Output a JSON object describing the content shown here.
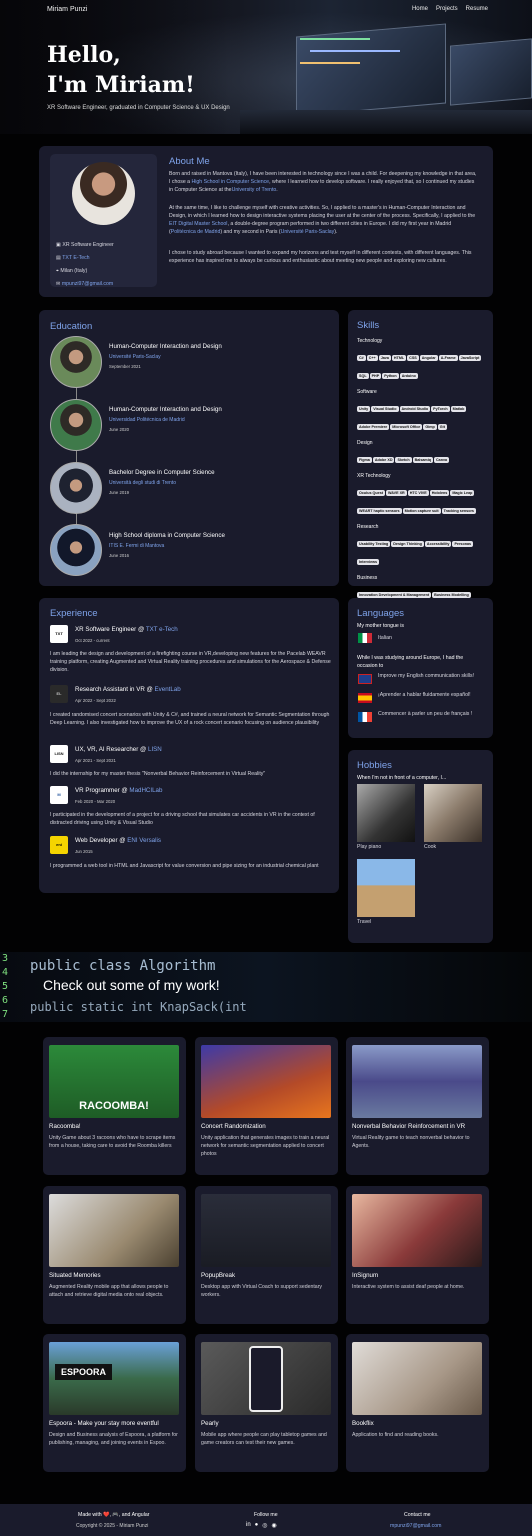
{
  "nav": {
    "brand": "Miriam Punzi",
    "links": [
      "Home",
      "Projects",
      "Resume"
    ]
  },
  "hero": {
    "line1": "Hello,",
    "line2": "I'm Miriam!",
    "subtitle": "XR Software Engineer, graduated in Computer Science & UX Design"
  },
  "profile": {
    "role": "XR Software Engineer",
    "company": "TXT E-Tech",
    "location": "Milan (Italy)",
    "email": "mpunzi97@gmail.com"
  },
  "about": {
    "title": "About Me",
    "p1a": "Born and raised in Mantova (Italy), I have been interested in technology since I was a child. For deepening my knowledge in that area, I chose a ",
    "p1l1": "High School in Computer Science",
    "p1b": ", where I learned how to develop software. I really enjoyed that, so I continued my studies in Computer Science at the",
    "p1l2": "University of Trento",
    "p1c": ".",
    "p2a": "At the same time, I like to challenge myself with creative activities. So, I applied to a master's in Human-Computer Interaction and Design, in which I learned how to design interactive systems placing the user at the center of the process. Specifically, I applied to the ",
    "p2l1": "EIT Digital Master School",
    "p2b": ", a double-degree program performed in two different cities in Europe. I did my first year in Madrid (",
    "p2l2": "Politécnica de Madrid",
    "p2c": ") and my second in Paris (",
    "p2l3": "Université Paris-Saclay",
    "p2d": ").",
    "p3": "I chose to study abroad because I wanted to expand my horizons and test myself in different contexts, with different languages. This experience has inspired me to always be curious and enthusiastic about meeting new people and exploring new cultures."
  },
  "education": {
    "title": "Education",
    "items": [
      {
        "title": "Human-Computer Interaction and Design",
        "school": "Université Paris-Saclay",
        "date": "September 2021"
      },
      {
        "title": "Human-Computer Interaction and Design",
        "school": "Universidad Politécnica de Madrid",
        "date": "June 2020"
      },
      {
        "title": "Bachelor Degree in Computer Science",
        "school": "Università degli studi di Trento",
        "date": "June 2019"
      },
      {
        "title": "High School diploma in Computer Science",
        "school": "ITIS E. Fermi di Mantova",
        "date": "June 2016"
      }
    ]
  },
  "skills": {
    "title": "Skills",
    "groups": [
      {
        "name": "Technology",
        "tags": [
          "C#",
          "C++",
          "Java",
          "HTML",
          "CSS",
          "Angular",
          "A-Frame",
          "JavaScript",
          "SQL",
          "PHP",
          "Python",
          "Arduino"
        ]
      },
      {
        "name": "Software",
        "tags": [
          "Unity",
          "Visual Studio",
          "Android Studio",
          "PyTorch",
          "Matlab",
          "Adobe Premiere",
          "Microsoft Office",
          "Gimp",
          "Git"
        ]
      },
      {
        "name": "Design",
        "tags": [
          "Figma",
          "Adobe XD",
          "Sketch",
          "Balsamiq",
          "Canva"
        ]
      },
      {
        "name": "XR Technology",
        "tags": [
          "Oculus Quest",
          "WAVE XR",
          "HTC VIVE",
          "Hololens",
          "Magic Leap",
          "WEART haptic sensors",
          "Motion capture suit",
          "Tracking sensors"
        ]
      },
      {
        "name": "Research",
        "tags": [
          "Usability Testing",
          "Design Thinking",
          "Accessibility",
          "Personas",
          "Interviews"
        ]
      },
      {
        "name": "Business",
        "tags": [
          "Innovation Development & Management",
          "Business Modelling",
          "Pitching"
        ]
      }
    ]
  },
  "experience": {
    "title": "Experience",
    "items": [
      {
        "role": "XR Software Engineer @ ",
        "org": "TXT e-Tech",
        "logo": "TXT",
        "date": "Oct 2022 - current",
        "desc": "I am leading the design and development of a firefighting course in VR,developing new features for the Pacelab WEAVR training platform, creating Augmented and Virtual Reality training procedures and simulations for the Aerospace & Defense division."
      },
      {
        "role": "Research Assistant in VR @ ",
        "org": "EventLab",
        "logo": "EL",
        "date": "Apr 2022 - Sept 2022",
        "desc": "I created randomised concert scenarios with Unity & C#, and trained a neural network for Semantic Segmentation through Deep Learning. I also investigated how to improve the UX of a rock concert scenario focusing on audience plausibility"
      },
      {
        "role": "UX, VR, AI Researcher @ ",
        "org": "LISN",
        "logo": "LISN",
        "date": "Apr 2021 - Sept 2021",
        "desc": "I did the internship for my master thesis \"Nonverbal Behavior Reinforcement in Virtual Reality\""
      },
      {
        "role": "VR Programmer @ ",
        "org": "MadHCILab",
        "logo": "M",
        "date": "Feb 2020 - Mar 2020",
        "desc": "I participated in the development of a project for a driving school that simulates car accidents in VR in the context of distracted driving using Unity & Visual Studio"
      },
      {
        "role": "Web Developer @ ",
        "org": "ENI Versalis",
        "logo": "eni",
        "date": "Jun 2015",
        "desc": "I programmed a web tool in HTML and Javascript for value conversion and pipe sizing for an industrial chemical plant"
      }
    ]
  },
  "languages": {
    "title": "Languages",
    "mother_label": "My mother tongue is",
    "mother": "Italian",
    "abroad_label": "While I was studying around Europe, I had the occasion to",
    "items": [
      "Improve my English communication skills!",
      "¡Aprender a hablar fluidamente español!",
      "Commencer à parler un peu de français !"
    ]
  },
  "hobbies": {
    "title": "Hobbies",
    "intro": "When I'm not in front of a computer, I...",
    "items": [
      "Play piano",
      "Cook",
      "Travel"
    ]
  },
  "banner": {
    "title": "Check out some of my work!",
    "code1": "public class Algorithm",
    "code2": "public static int KnapSack(int"
  },
  "projects": [
    {
      "title": "Racoomba!",
      "desc": "Unity Game about 3 racoons who have to scrape items from a house, taking care to avoid the Roomba killers",
      "img_text": "RACOOMBA!"
    },
    {
      "title": "Concert Randomization",
      "desc": "Unity application that generates images to train a neural network for semantic segmentation applied to concert photos",
      "img_text": ""
    },
    {
      "title": "Nonverbal Behavior Reinforcement in VR",
      "desc": "Virtual Reality game to teach nonverbal behavior to Agents.",
      "img_text": ""
    },
    {
      "title": "Situated Memories",
      "desc": "Augmented Reality mobile app that allows people to attach and retrieve digital media onto real objects.",
      "img_text": ""
    },
    {
      "title": "PopupBreak",
      "desc": "Desktop app with Virtual Coach to support sedentary workers.",
      "img_text": ""
    },
    {
      "title": "InSignum",
      "desc": "Interactive system to assist deaf people at home.",
      "img_text": ""
    },
    {
      "title": "Espoora - Make your stay more eventful",
      "desc": "Design and Business analysis of Espoora, a platform for publishing, managing, and joining events in Espoo.",
      "img_text": "ESPOORA"
    },
    {
      "title": "Pearly",
      "desc": "Mobile app where people can play tabletop games and game creators can test their new games.",
      "img_text": ""
    },
    {
      "title": "Bookflix",
      "desc": "Application to find and reading books.",
      "img_text": ""
    }
  ],
  "footer": {
    "made_with": "Made with ❤️, 🎮, and Angular",
    "copyright": "Copyright © 2025 - Miriam Punzi",
    "follow": "Follow me",
    "contact": "Contact me",
    "email": "mpunzi97@gmail.com"
  }
}
